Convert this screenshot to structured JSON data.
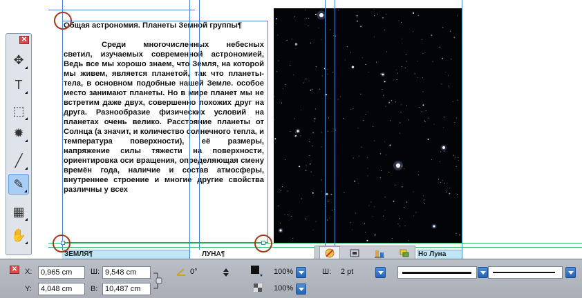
{
  "document": {
    "heading": "Общая астрономия. Планеты Земной группы¶",
    "body": "Среди многочисленных небесных светил, изучаемых современной астрономией, Ведь все мы хорошо знаем, что Земля, на которой мы живем, является планетой, так что планеты-тела, в основном подобные нашей Земле. особое место занимают планеты. Но в мире планет мы не встретим даже двух, совершенно похожих друг на друга. Разнообразие физических условий на планетах очень велико. Расстояние планеты от Солнца (а значит, и количество солнечного тепла, и температура поверхности), её размеры, напряжение силы тяжести на поверхности, ориентировка оси вращения, определяющая смену времён года, наличие и состав атмосферы, внутреннее строение и многие другие свойства различны у всех",
    "cell_earth": "ЗЕМЛЯ¶",
    "cell_moon": "ЛУНА¶",
    "cell_right": "Но Луна"
  },
  "palette": {
    "close_icon": "close-icon",
    "tools": [
      {
        "name": "move-tool",
        "glyph": "✥"
      },
      {
        "name": "text-tool",
        "glyph": "T"
      },
      {
        "name": "frame-tool",
        "glyph": "⬚"
      },
      {
        "name": "star-shape-tool",
        "glyph": "✹"
      },
      {
        "name": "line-tool",
        "glyph": "╱"
      },
      {
        "name": "bezier-tool",
        "glyph": "✎"
      },
      {
        "name": "table-tool",
        "glyph": "▦"
      },
      {
        "name": "hand-tool",
        "glyph": "✋"
      }
    ],
    "active_tool": "bezier-tool"
  },
  "properties": {
    "x_label": "X:",
    "x_value": "0,965 cm",
    "y_label": "Y:",
    "y_value": "4,048 cm",
    "w_label": "Ш:",
    "w_value": "9,548 cm",
    "h_label": "В:",
    "h_value": "10,487 cm",
    "angle_value": "0°",
    "fill_opacity": "100%",
    "stroke_opacity": "100%",
    "stroke_width_label": "Ш:",
    "stroke_width_value": "2 pt"
  },
  "colors": {
    "guide": "#4a7fd6",
    "baseline": "#2dbf6a",
    "cell_fill": "#bfe5f7",
    "handle": "#a0391b"
  }
}
